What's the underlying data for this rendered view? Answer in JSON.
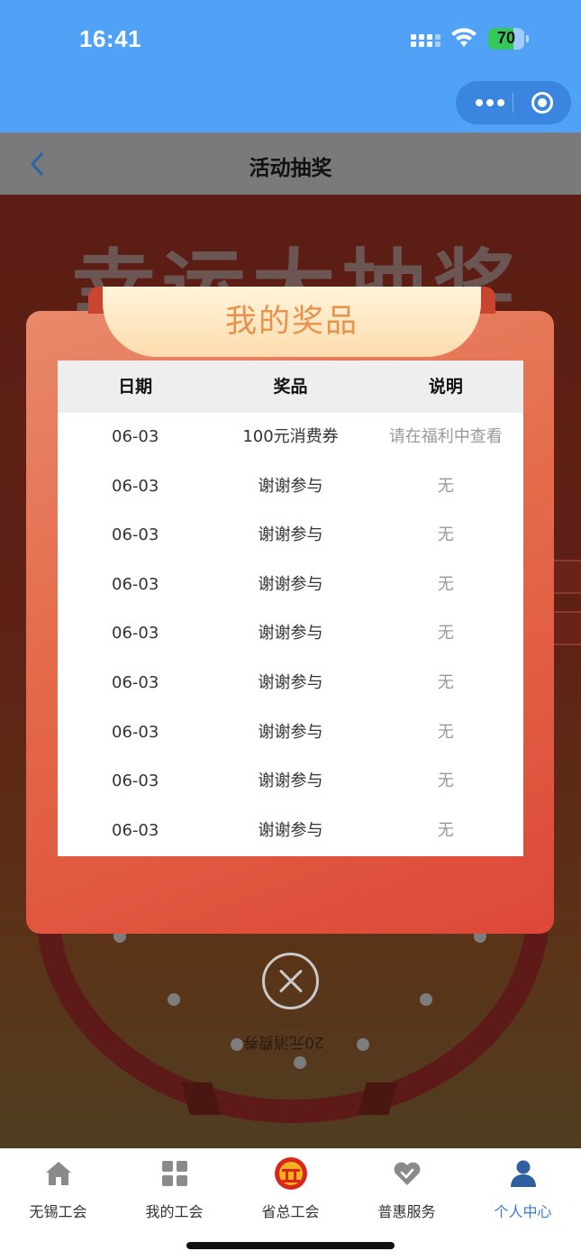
{
  "status_bar": {
    "time": "16:41",
    "battery": "70"
  },
  "nav": {
    "title": "活动抽奖"
  },
  "background": {
    "banner": "幸运大抽奖",
    "prize_text": "20元消费券"
  },
  "modal": {
    "title": "我的奖品",
    "columns": [
      "日期",
      "奖品",
      "说明"
    ],
    "rows": [
      {
        "date": "06-03",
        "prize": "100元消费券",
        "note": "请在福利中查看"
      },
      {
        "date": "06-03",
        "prize": "谢谢参与",
        "note": "无"
      },
      {
        "date": "06-03",
        "prize": "谢谢参与",
        "note": "无"
      },
      {
        "date": "06-03",
        "prize": "谢谢参与",
        "note": "无"
      },
      {
        "date": "06-03",
        "prize": "谢谢参与",
        "note": "无"
      },
      {
        "date": "06-03",
        "prize": "谢谢参与",
        "note": "无"
      },
      {
        "date": "06-03",
        "prize": "谢谢参与",
        "note": "无"
      },
      {
        "date": "06-03",
        "prize": "谢谢参与",
        "note": "无"
      },
      {
        "date": "06-03",
        "prize": "谢谢参与",
        "note": "无"
      }
    ]
  },
  "tabbar": {
    "items": [
      {
        "label": "无锡工会",
        "icon": "home-icon"
      },
      {
        "label": "我的工会",
        "icon": "grid-icon"
      },
      {
        "label": "省总工会",
        "icon": "union-emblem-icon"
      },
      {
        "label": "普惠服务",
        "icon": "heart-icon"
      },
      {
        "label": "个人中心",
        "icon": "person-icon"
      }
    ],
    "active_color": "#3a7bd5"
  },
  "colors": {
    "accent": "#50a2f7",
    "modal_gradient_start": "#e8896a",
    "modal_gradient_end": "#dd4838",
    "ribbon_text": "#e7924a"
  }
}
